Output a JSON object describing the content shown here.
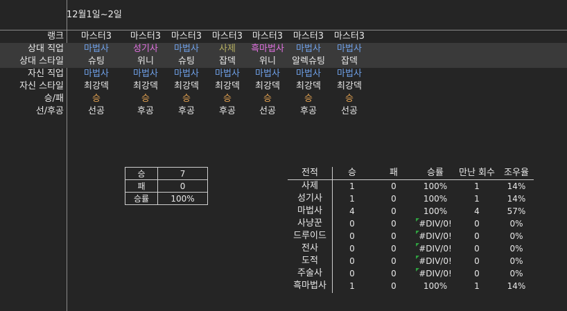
{
  "header": {
    "date_range": "12월1일~2일"
  },
  "row_labels": [
    "랭크",
    "상대 직업",
    "상대 스타일",
    "자신 직업",
    "자신 스타일",
    "승/패",
    "선/후공"
  ],
  "games": [
    {
      "rank": "마스터3",
      "opp_class": "마법사",
      "opp_class_color": "blue",
      "opp_style": "슈팅",
      "my_class": "마법사",
      "my_style": "최강덱",
      "result": "승",
      "turn": "선공"
    },
    {
      "rank": "마스터3",
      "opp_class": "성기사",
      "opp_class_color": "pink",
      "opp_style": "위니",
      "my_class": "마법사",
      "my_style": "최강덱",
      "result": "승",
      "turn": "후공"
    },
    {
      "rank": "마스터3",
      "opp_class": "마법사",
      "opp_class_color": "blue",
      "opp_style": "슈팅",
      "my_class": "마법사",
      "my_style": "최강덱",
      "result": "승",
      "turn": "후공"
    },
    {
      "rank": "마스터3",
      "opp_class": "사제",
      "opp_class_color": "olive",
      "opp_style": "잡덱",
      "my_class": "마법사",
      "my_style": "최강덱",
      "result": "승",
      "turn": "후공"
    },
    {
      "rank": "마스터3",
      "opp_class": "흑마법사",
      "opp_class_color": "pink",
      "opp_style": "위니",
      "my_class": "마법사",
      "my_style": "최강덱",
      "result": "승",
      "turn": "선공"
    },
    {
      "rank": "마스터3",
      "opp_class": "마법사",
      "opp_class_color": "blue",
      "opp_style": "알렉슈팅",
      "my_class": "마법사",
      "my_style": "최강덱",
      "result": "승",
      "turn": "후공"
    },
    {
      "rank": "마스터3",
      "opp_class": "마법사",
      "opp_class_color": "blue",
      "opp_style": "잡덱",
      "my_class": "마법사",
      "my_style": "최강덱",
      "result": "승",
      "turn": "선공"
    }
  ],
  "summary": {
    "win_label": "승",
    "win_value": "7",
    "loss_label": "패",
    "loss_value": "0",
    "rate_label": "승률",
    "rate_value": "100%"
  },
  "record_table": {
    "headers": [
      "전적",
      "승",
      "패",
      "승률",
      "만난 회수",
      "조우율"
    ],
    "rows": [
      {
        "name": "사제",
        "win": "1",
        "loss": "0",
        "rate": "100%",
        "met": "1",
        "enc": "14%"
      },
      {
        "name": "성기사",
        "win": "1",
        "loss": "0",
        "rate": "100%",
        "met": "1",
        "enc": "14%"
      },
      {
        "name": "마법사",
        "win": "4",
        "loss": "0",
        "rate": "100%",
        "met": "4",
        "enc": "57%"
      },
      {
        "name": "사냥꾼",
        "win": "0",
        "loss": "0",
        "rate": "#DIV/0!",
        "met": "0",
        "enc": "0%"
      },
      {
        "name": "드루이드",
        "win": "0",
        "loss": "0",
        "rate": "#DIV/0!",
        "met": "0",
        "enc": "0%"
      },
      {
        "name": "전사",
        "win": "0",
        "loss": "0",
        "rate": "#DIV/0!",
        "met": "0",
        "enc": "0%"
      },
      {
        "name": "도적",
        "win": "0",
        "loss": "0",
        "rate": "#DIV/0!",
        "met": "0",
        "enc": "0%"
      },
      {
        "name": "주술사",
        "win": "0",
        "loss": "0",
        "rate": "#DIV/0!",
        "met": "0",
        "enc": "0%"
      },
      {
        "name": "흑마법사",
        "win": "1",
        "loss": "0",
        "rate": "100%",
        "met": "1",
        "enc": "14%"
      }
    ]
  },
  "colors": {
    "blue": "#6fa0e8",
    "pink": "#e070e0",
    "olive": "#b6b060",
    "orange": "#e0a050",
    "error_mark": "#2fa040"
  }
}
